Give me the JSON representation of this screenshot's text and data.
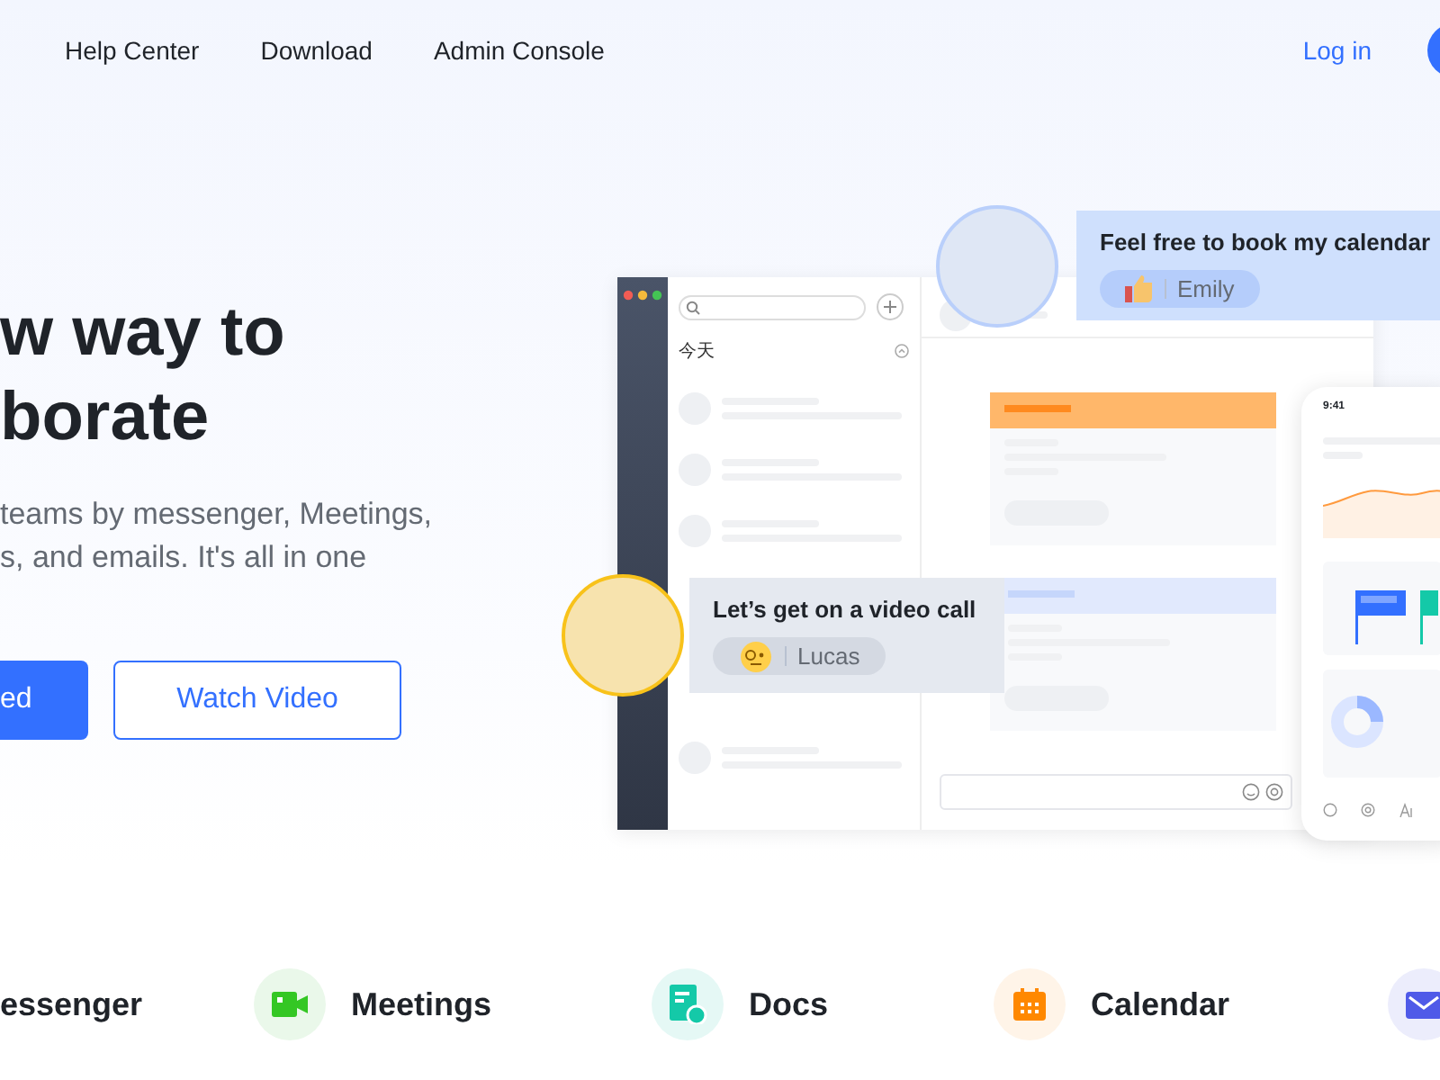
{
  "nav": {
    "links": [
      "Help Center",
      "Download",
      "Admin Console"
    ],
    "login": "Log in"
  },
  "hero": {
    "title_lines": [
      "w way to",
      "borate"
    ],
    "description_lines": [
      "teams by messenger, Meetings,",
      "s, and emails. It's all in one"
    ],
    "primary_button": "ed",
    "secondary_button": "Watch Video"
  },
  "illustration": {
    "list_heading": "今天",
    "phone_time": "9:41",
    "emily_message": {
      "text": "Feel free to book my calendar",
      "name": "Emily"
    },
    "lucas_message": {
      "text": "Let’s get on a video call",
      "name": "Lucas"
    }
  },
  "features": [
    {
      "kind": "messenger",
      "label": "essenger"
    },
    {
      "kind": "meetings",
      "label": "Meetings"
    },
    {
      "kind": "docs",
      "label": "Docs"
    },
    {
      "kind": "calendar",
      "label": "Calendar"
    },
    {
      "kind": "mail"
    }
  ]
}
